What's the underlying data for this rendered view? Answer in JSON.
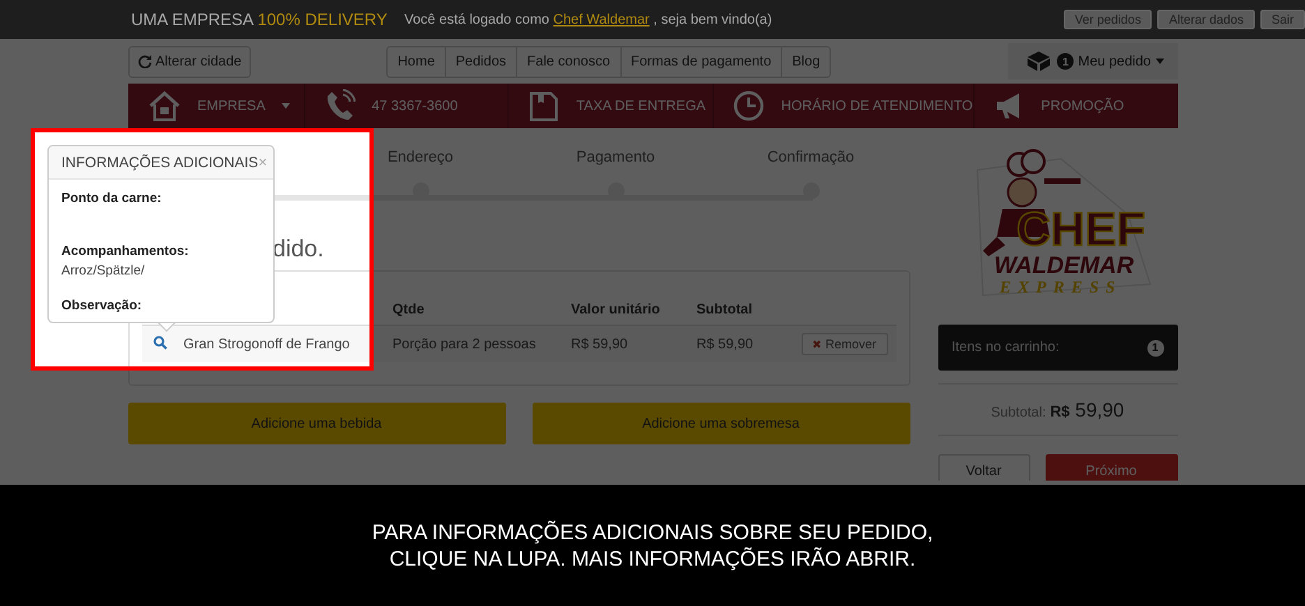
{
  "top_bar": {
    "brand": "UMA EMPRESA",
    "brand_highlight": "100% DELIVERY",
    "welcome_prefix": "Você está logado como",
    "user": "Chef Waldemar",
    "welcome_suffix": ", seja bem vindo(a)",
    "buttons": [
      "Ver pedidos",
      "Alterar dados",
      "Sair"
    ]
  },
  "nav": {
    "city_button": "Alterar cidade",
    "links": [
      "Home",
      "Pedidos",
      "Fale conosco",
      "Formas de pagamento",
      "Blog"
    ],
    "cart_count": "1",
    "cart_label": "Meu pedido"
  },
  "info_bar": [
    {
      "kind": "house",
      "label": "EMPRESA",
      "dropdown": true
    },
    {
      "kind": "phone",
      "label": "47 3367-3600",
      "dropdown": false
    },
    {
      "kind": "box",
      "label": "TAXA DE ENTREGA",
      "dropdown": false
    },
    {
      "kind": "clock",
      "label": "HORÁRIO DE ATENDIMENTO",
      "dropdown": false
    },
    {
      "kind": "megaphone",
      "label": "PROMOÇÃO",
      "dropdown": false
    }
  ],
  "steps": [
    {
      "label": "Endereço"
    },
    {
      "label": "Pagamento"
    },
    {
      "label": "Confirmação"
    }
  ],
  "heading": "dido.",
  "table": {
    "columns": [
      "Qtde",
      "Valor unitário",
      "Subtotal"
    ],
    "rows": [
      {
        "item": "Gran Strogonoff de Frango",
        "qty": "Porção para 2 pessoas",
        "unit_price": "R$ 59,90",
        "subtotal": "R$ 59,90",
        "action_icon": "✖",
        "action": "Remover"
      }
    ]
  },
  "add_buttons": [
    "Adicione uma bebida",
    "Adicione uma sobremesa"
  ],
  "sidebar": {
    "logo": {
      "line1": "CHEF",
      "line2": "WALDEMAR",
      "line3": "EXPRESS"
    },
    "cart_label": "Itens no carrinho:",
    "cart_count": "1",
    "subtotal_label": "Subtotal:",
    "subtotal_currency": "R$",
    "subtotal_value": "59,90",
    "buttons": [
      "Voltar",
      "Próximo"
    ]
  },
  "popover": {
    "title": "INFORMAÇÕES ADICIONAIS",
    "close": "×",
    "fields": [
      {
        "label": "Ponto da carne:"
      },
      {
        "label": "Acompanhamentos:",
        "value": "Arroz/Spätzle/"
      },
      {
        "label": "Observação:"
      }
    ]
  },
  "caption": [
    "PARA INFORMAÇÕES ADICIONAIS SOBRE SEU PEDIDO,",
    "CLIQUE NA LUPA. MAIS INFORMAÇÕES IRÃO ABRIR."
  ]
}
